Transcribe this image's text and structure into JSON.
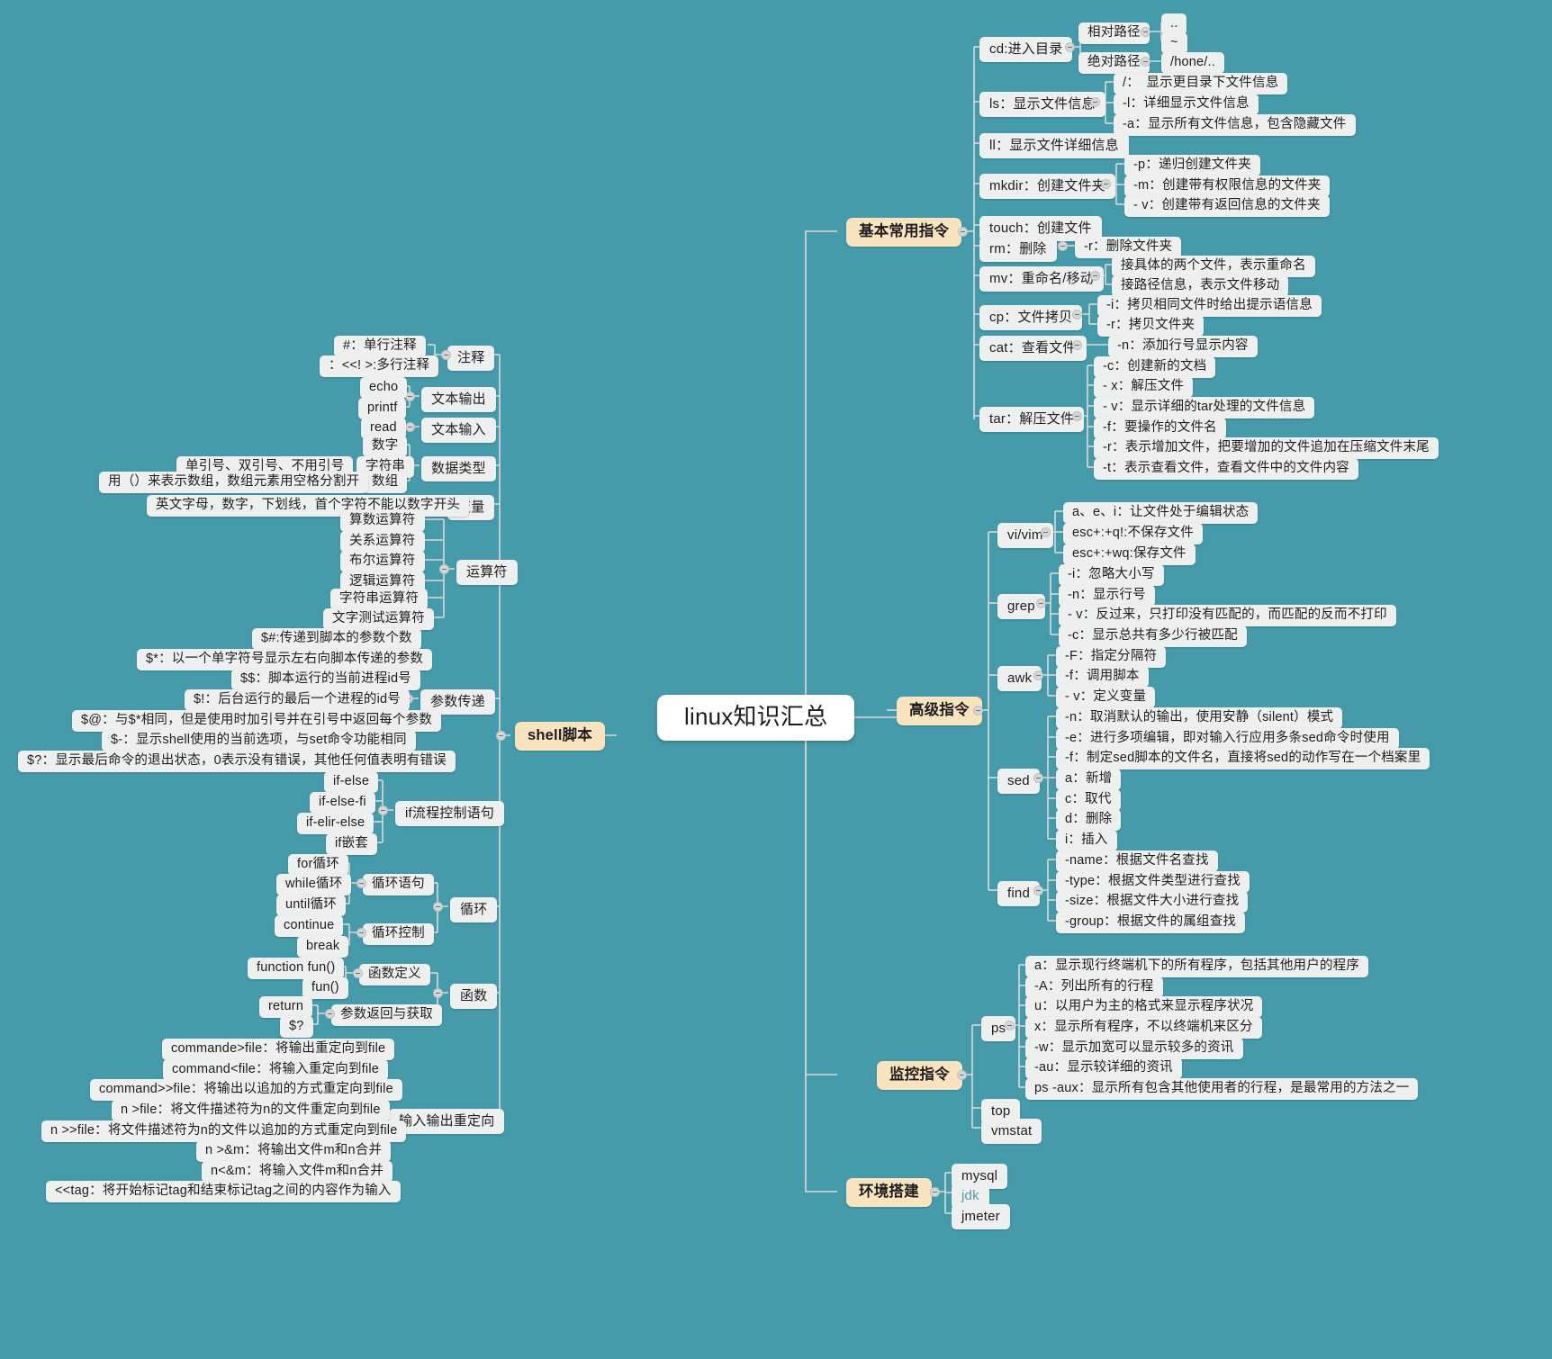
{
  "meta": {
    "background_color": "#469bab",
    "node_color": "#eeefef",
    "category_color": "#fae3bf",
    "root_color": "#ffffff",
    "line_color": "#d8dada"
  },
  "root": {
    "label": "linux知识汇总"
  },
  "categories": {
    "basic": "基本常用指令",
    "advanced": "高级指令",
    "monitor": "监控指令",
    "env": "环境搭建",
    "shell": "shell脚本"
  },
  "basic": {
    "cd": {
      "label": "cd:进入目录",
      "children": [
        {
          "label": "相对路径",
          "children": [
            {
              "label": ".."
            },
            {
              "label": "~"
            }
          ]
        },
        {
          "label": "绝对路径",
          "children": [
            {
              "label": "/hone/.."
            }
          ]
        }
      ]
    },
    "ls": {
      "label": "ls：显示文件信息",
      "children": [
        {
          "label": "/：　显示更目录下文件信息"
        },
        {
          "label": "-l：详细显示文件信息"
        },
        {
          "label": "-a：显示所有文件信息，包含隐藏文件"
        }
      ]
    },
    "ll": {
      "label": "ll：显示文件详细信息"
    },
    "mkdir": {
      "label": "mkdir：创建文件夹",
      "children": [
        {
          "label": "-p：递归创建文件夹"
        },
        {
          "label": "-m：创建带有权限信息的文件夹"
        },
        {
          "label": "- v：创建带有返回信息的文件夹"
        }
      ]
    },
    "touch": {
      "label": "touch：创建文件"
    },
    "rm": {
      "label": "rm：删除",
      "children": [
        {
          "label": "-r：删除文件夹"
        }
      ]
    },
    "mv": {
      "label": "mv：重命名/移动",
      "children": [
        {
          "label": "接具体的两个文件，表示重命名"
        },
        {
          "label": "接路径信息，表示文件移动"
        }
      ]
    },
    "cp": {
      "label": "cp：文件拷贝",
      "children": [
        {
          "label": "-i：拷贝相同文件时给出提示语信息"
        },
        {
          "label": "-r：拷贝文件夹"
        }
      ]
    },
    "cat": {
      "label": "cat：查看文件",
      "children": [
        {
          "label": "-n：添加行号显示内容"
        }
      ]
    },
    "tar": {
      "label": "tar：解压文件",
      "children": [
        {
          "label": "-c：创建新的文档"
        },
        {
          "label": "- x：解压文件"
        },
        {
          "label": "- v：显示详细的tar处理的文件信息"
        },
        {
          "label": "-f：要操作的文件名"
        },
        {
          "label": "-r：表示增加文件，把要增加的文件追加在压缩文件末尾"
        },
        {
          "label": "-t：表示查看文件，查看文件中的文件内容"
        }
      ]
    }
  },
  "advanced": {
    "vivim": {
      "label": "vi/vim",
      "children": [
        {
          "label": "a、e、i：让文件处于编辑状态"
        },
        {
          "label": "esc+:+q!:不保存文件"
        },
        {
          "label": "esc+:+wq:保存文件"
        }
      ]
    },
    "grep": {
      "label": "grep",
      "children": [
        {
          "label": "-i：忽略大小写"
        },
        {
          "label": "-n：显示行号"
        },
        {
          "label": "- v：反过来，只打印没有匹配的，而匹配的反而不打印"
        },
        {
          "label": "-c：显示总共有多少行被匹配"
        }
      ]
    },
    "awk": {
      "label": "awk",
      "children": [
        {
          "label": "-F：指定分隔符"
        },
        {
          "label": "-f：调用脚本"
        },
        {
          "label": "- v：定义变量"
        }
      ]
    },
    "sed": {
      "label": "sed",
      "children": [
        {
          "label": "-n：取消默认的输出，使用安静（silent）模式"
        },
        {
          "label": "-e：进行多项编辑，即对输入行应用多条sed命令时使用"
        },
        {
          "label": "-f：制定sed脚本的文件名，直接将sed的动作写在一个档案里"
        },
        {
          "label": "a：新增"
        },
        {
          "label": "c：取代"
        },
        {
          "label": "d：删除"
        },
        {
          "label": "i：插入"
        }
      ]
    },
    "find": {
      "label": "find",
      "children": [
        {
          "label": "-name：根据文件名查找"
        },
        {
          "label": "-type：根据文件类型进行查找"
        },
        {
          "label": "-size：根据文件大小进行查找"
        },
        {
          "label": "-group：根据文件的属组查找"
        }
      ]
    }
  },
  "monitor": {
    "ps": {
      "label": "ps",
      "children": [
        {
          "label": "a：显示现行终端机下的所有程序，包括其他用户的程序"
        },
        {
          "label": "-A：列出所有的行程"
        },
        {
          "label": "u：以用户为主的格式来显示程序状况"
        },
        {
          "label": "x：显示所有程序，不以终端机来区分"
        },
        {
          "label": "-w：显示加宽可以显示较多的资讯"
        },
        {
          "label": "-au：显示较详细的资讯"
        },
        {
          "label": "ps -aux：显示所有包含其他使用者的行程，是最常用的方法之一"
        }
      ]
    },
    "top": {
      "label": "top"
    },
    "vmstat": {
      "label": "vmstat"
    }
  },
  "env": {
    "items": [
      {
        "label": "mysql"
      },
      {
        "label": "jdk"
      },
      {
        "label": "jmeter"
      }
    ]
  },
  "shell": {
    "comment": {
      "label": "注释",
      "children": [
        {
          "label": "#：单行注释"
        },
        {
          "label": "：<<! >:多行注释"
        }
      ]
    },
    "textout": {
      "label": "文本输出",
      "children": [
        {
          "label": "echo"
        },
        {
          "label": "printf"
        }
      ]
    },
    "textin": {
      "label": "文本输入",
      "children": [
        {
          "label": "read"
        }
      ]
    },
    "datatype": {
      "label": "数据类型",
      "children": [
        {
          "label": "数字"
        },
        {
          "label": "字符串",
          "note": "单引号、双引号、不用引号"
        },
        {
          "label": "数组",
          "note": "用（）来表示数组，数组元素用空格分割开"
        }
      ]
    },
    "variable": {
      "label": "变量",
      "children": [
        {
          "label": "英文字母，数字，下划线，首个字符不能以数字开头"
        }
      ]
    },
    "operator": {
      "label": "运算符",
      "children": [
        {
          "label": "算数运算符"
        },
        {
          "label": "关系运算符"
        },
        {
          "label": "布尔运算符"
        },
        {
          "label": "逻辑运算符"
        },
        {
          "label": "字符串运算符"
        },
        {
          "label": "文字测试运算符"
        }
      ]
    },
    "params": {
      "label": "参数传递",
      "children": [
        {
          "label": "$#:传递到脚本的参数个数"
        },
        {
          "label": "$*：以一个单字符号显示左右向脚本传递的参数"
        },
        {
          "label": "$$：脚本运行的当前进程id号"
        },
        {
          "label": "$!：后台运行的最后一个进程的id号"
        },
        {
          "label": "$@：与$*相同，但是使用时加引号并在引号中返回每个参数"
        },
        {
          "label": "$-：显示shell使用的当前选项，与set命令功能相同"
        },
        {
          "label": "$?：显示最后命令的退出状态，0表示没有错误，其他任何值表明有错误"
        }
      ]
    },
    "ifctrl": {
      "label": "if流程控制语句",
      "children": [
        {
          "label": "if-else"
        },
        {
          "label": "if-else-fi"
        },
        {
          "label": "if-elir-else"
        },
        {
          "label": "if嵌套"
        }
      ]
    },
    "loop": {
      "label": "循环",
      "children": [
        {
          "label": "循环语句",
          "children": [
            {
              "label": "for循环"
            },
            {
              "label": "while循环"
            },
            {
              "label": "until循环"
            }
          ]
        },
        {
          "label": "循环控制",
          "children": [
            {
              "label": "continue"
            },
            {
              "label": "break"
            }
          ]
        }
      ]
    },
    "function": {
      "label": "函数",
      "children": [
        {
          "label": "函数定义",
          "children": [
            {
              "label": "function fun()"
            },
            {
              "label": "fun()"
            }
          ]
        },
        {
          "label": "参数返回与获取",
          "children": [
            {
              "label": "return"
            },
            {
              "label": "$?"
            }
          ]
        }
      ]
    },
    "redirect": {
      "label": "输入输出重定向",
      "children": [
        {
          "label": "commande>file：将输出重定向到file"
        },
        {
          "label": "command<file：将输入重定向到file"
        },
        {
          "label": "command>>file：将输出以追加的方式重定向到file"
        },
        {
          "label": "n >file：将文件描述符为n的文件重定向到file"
        },
        {
          "label": "n >>file：将文件描述符为n的文件以追加的方式重定向到file"
        },
        {
          "label": "n >&m：将输出文件m和n合并"
        },
        {
          "label": "n<&m：将输入文件m和n合并"
        },
        {
          "label": "<<tag：将开始标记tag和结束标记tag之间的内容作为输入"
        }
      ]
    }
  }
}
